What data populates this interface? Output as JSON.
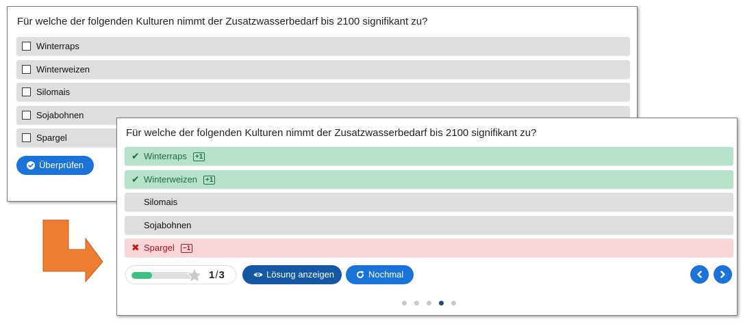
{
  "colors": {
    "primary_button": "#1a73d9",
    "solution_button": "#1558a6",
    "correct_bg": "#b6e2cc",
    "correct_text": "#1f6b43",
    "wrong_bg": "#f8d6d8",
    "wrong_text": "#b5121f",
    "neutral_bg": "#dedede",
    "arrow": "#ed7d31"
  },
  "before": {
    "question": "Für welche der folgenden Kulturen nimmt der Zusatzwasserbedarf bis 2100 signifikant zu?",
    "answers": [
      {
        "label": "Winterraps",
        "checked": false
      },
      {
        "label": "Winterweizen",
        "checked": false
      },
      {
        "label": "Silomais",
        "checked": false
      },
      {
        "label": "Sojabohnen",
        "checked": false
      },
      {
        "label": "Spargel",
        "checked": false
      }
    ],
    "check_button": {
      "label": "Überprüfen",
      "icon": "check-circle-icon"
    }
  },
  "after": {
    "question": "Für welche der folgenden Kulturen nimmt der Zusatzwasserbedarf bis 2100 signifikant zu?",
    "answers": [
      {
        "label": "Winterraps",
        "state": "correct",
        "icon": "checkmark-icon",
        "badge": "+1"
      },
      {
        "label": "Winterweizen",
        "state": "correct",
        "icon": "checkmark-icon",
        "badge": "+1"
      },
      {
        "label": "Silomais",
        "state": "neutral"
      },
      {
        "label": "Sojabohnen",
        "state": "neutral"
      },
      {
        "label": "Spargel",
        "state": "wrong",
        "icon": "cross-icon",
        "badge": "−1"
      }
    ],
    "score": {
      "value": "1",
      "separator": "/",
      "max": "3",
      "progress_fraction": 0.33,
      "icon": "star-icon"
    },
    "solution_button": {
      "label": "Lösung anzeigen",
      "icon": "eye-icon"
    },
    "retry_button": {
      "label": "Nochmal",
      "icon": "retry-icon"
    },
    "navigation": {
      "prev_icon": "chevron-left-icon",
      "next_icon": "chevron-right-icon"
    },
    "pager": {
      "count": 5,
      "active_index": 3
    }
  },
  "arrow": {
    "icon": "bent-arrow-icon"
  }
}
